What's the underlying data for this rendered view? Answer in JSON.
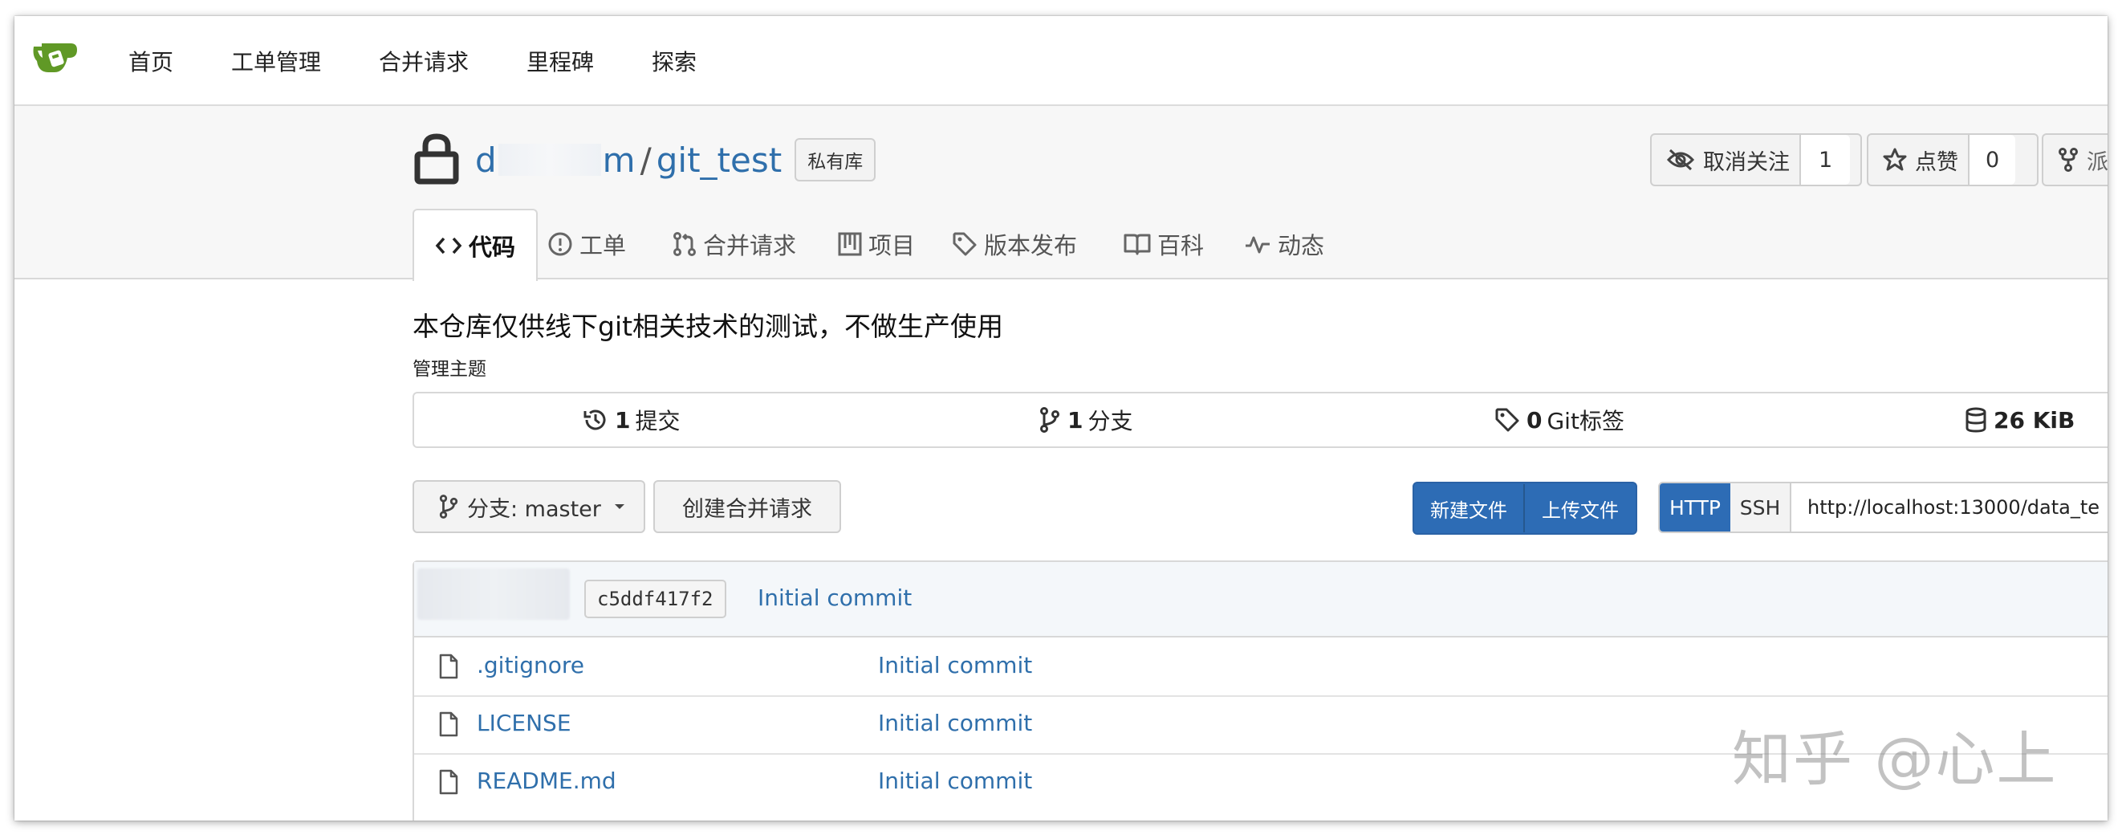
{
  "nav": {
    "items": [
      "首页",
      "工单管理",
      "合并请求",
      "里程碑",
      "探索"
    ]
  },
  "repo": {
    "owner_start": "d",
    "owner_end": "m",
    "separator": "/",
    "name": "git_test",
    "private_badge": "私有库",
    "watch_label": "取消关注",
    "watch_count": "1",
    "star_label": "点赞",
    "star_count": "0",
    "fork_label_partial": "派"
  },
  "tabs": [
    {
      "label": "代码",
      "icon": "code-icon"
    },
    {
      "label": "工单",
      "icon": "issue-icon"
    },
    {
      "label": "合并请求",
      "icon": "pull-request-icon"
    },
    {
      "label": "项目",
      "icon": "project-icon"
    },
    {
      "label": "版本发布",
      "icon": "tag-icon"
    },
    {
      "label": "百科",
      "icon": "book-icon"
    },
    {
      "label": "动态",
      "icon": "pulse-icon"
    }
  ],
  "description": "本仓库仅供线下git相关技术的测试，不做生产使用",
  "manage_topics": "管理主题",
  "stats": {
    "commits_count": "1",
    "commits_label": "提交",
    "branches_count": "1",
    "branches_label": "分支",
    "tags_count": "0",
    "tags_label": "Git标签",
    "size": "26 KiB"
  },
  "toolbar": {
    "branch_label": "分支: master",
    "create_pr": "创建合并请求",
    "new_file": "新建文件",
    "upload_file": "上传文件",
    "http": "HTTP",
    "ssh": "SSH",
    "clone_url": "http://localhost:13000/data_te"
  },
  "latest_commit": {
    "sha": "c5ddf417f2",
    "message": "Initial commit"
  },
  "files": [
    {
      "name": ".gitignore",
      "commit": "Initial commit"
    },
    {
      "name": "LICENSE",
      "commit": "Initial commit"
    },
    {
      "name": "README.md",
      "commit": "Initial commit"
    }
  ],
  "watermark": "知乎 @心上",
  "colors": {
    "accent": "#2f6fab",
    "primary_button": "#2d6cb5",
    "logo_green": "#609926"
  }
}
